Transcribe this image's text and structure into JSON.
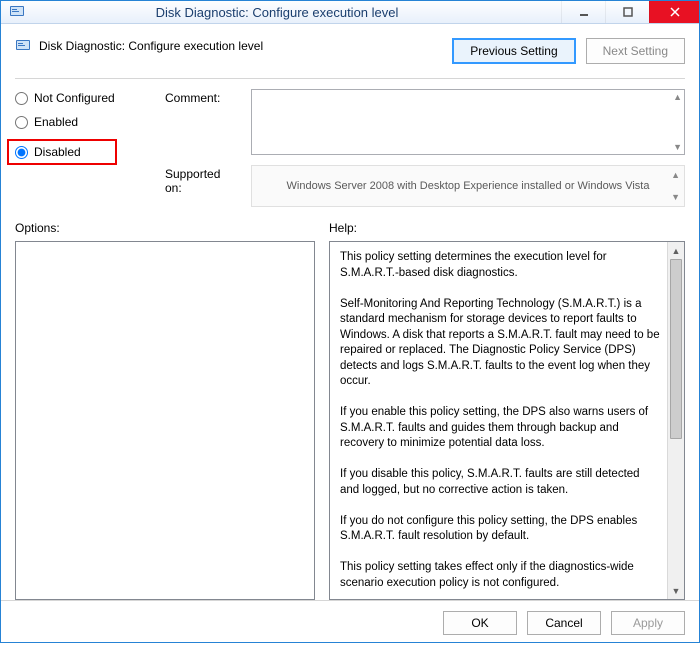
{
  "window": {
    "title": "Disk Diagnostic: Configure execution level"
  },
  "header": {
    "policy_title": "Disk Diagnostic: Configure execution level",
    "previous_setting": "Previous Setting",
    "next_setting": "Next Setting"
  },
  "radios": {
    "not_configured": "Not Configured",
    "enabled": "Enabled",
    "disabled": "Disabled",
    "selected": "disabled"
  },
  "fields": {
    "comment_label": "Comment:",
    "comment_value": "",
    "supported_label": "Supported on:",
    "supported_value": "Windows Server 2008 with Desktop Experience installed or Windows Vista"
  },
  "panels": {
    "options_label": "Options:",
    "help_label": "Help:",
    "help_text": "This policy setting determines the execution level for S.M.A.R.T.-based disk diagnostics.\n\nSelf-Monitoring And Reporting Technology (S.M.A.R.T.) is a standard mechanism for storage devices to report faults to Windows. A disk that reports a S.M.A.R.T. fault may need to be repaired or replaced. The Diagnostic Policy Service (DPS) detects and logs S.M.A.R.T. faults to the event log when they occur.\n\nIf you enable this policy setting, the DPS also warns users of S.M.A.R.T. faults and guides them through backup and recovery to minimize potential data loss.\n\nIf you disable this policy, S.M.A.R.T. faults are still detected and logged, but no corrective action is taken.\n\nIf you do not configure this policy setting, the DPS enables S.M.A.R.T. fault resolution by default.\n\nThis policy setting takes effect only if the diagnostics-wide scenario execution policy is not configured."
  },
  "footer": {
    "ok": "OK",
    "cancel": "Cancel",
    "apply": "Apply"
  }
}
